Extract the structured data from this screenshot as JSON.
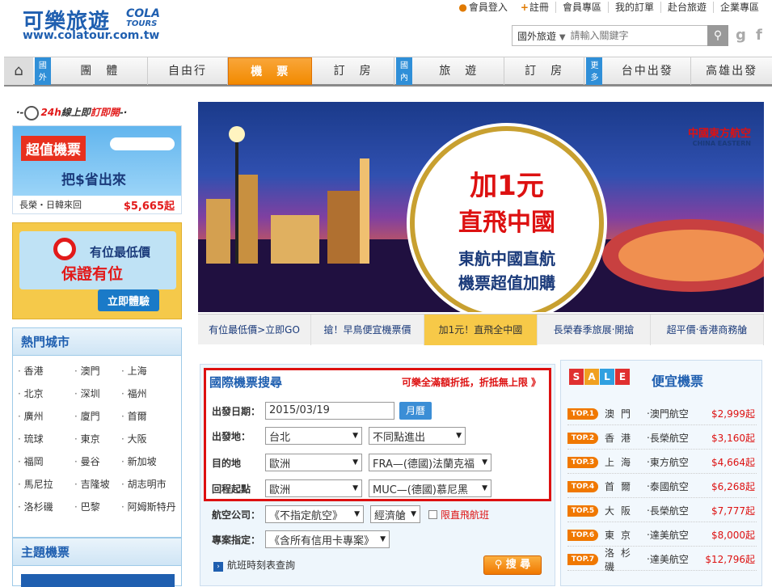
{
  "logo": {
    "cn": "可樂旅遊",
    "tag1": "COLA",
    "tag2": "TOURS",
    "url": "www.colatour.com.tw"
  },
  "toplinks": [
    "會員登入",
    "註冊",
    "會員專區",
    "我的訂單",
    "赴台旅遊",
    "企業專區"
  ],
  "search": {
    "category": "國外旅遊",
    "placeholder": "請輸入關鍵字"
  },
  "nav": {
    "tag_outer": "國外",
    "tag_inner": "國內",
    "tag_more": "更多",
    "items": [
      "團　體",
      "自由行",
      "機　票",
      "訂　房",
      "旅　遊",
      "訂　房",
      "台中出發",
      "高雄出發"
    ]
  },
  "left": {
    "promo24": {
      "prefix": "24h",
      "text": "線上即",
      "red": "訂即開"
    },
    "ad1": {
      "t1": "超值機票",
      "t2": "把$省出來",
      "route": "長榮・日韓來回",
      "price": "$5,665起"
    },
    "ad2": {
      "l1": "有位最低價",
      "l2": "保證有位",
      "btn": "立即體驗"
    },
    "city_title": "熱門城市",
    "cities": [
      "香港",
      "澳門",
      "上海",
      "北京",
      "深圳",
      "福州",
      "廣州",
      "廈門",
      "首爾",
      "琉球",
      "東京",
      "大阪",
      "福岡",
      "曼谷",
      "新加坡",
      "馬尼拉",
      "吉隆坡",
      "胡志明市",
      "洛杉磯",
      "巴黎",
      "阿姆斯特丹"
    ],
    "theme_title": "主題機票"
  },
  "banner": {
    "a1": "加1元",
    "a2": "直飛中國",
    "a3": "東航中國直航",
    "a4": "機票超值加購",
    "airline_cn": "中國東方航空",
    "airline_en": "CHINA EASTERN"
  },
  "banner_tabs": [
    "有位最低價>立即GO",
    "搶！早鳥便宜機票價",
    "加1元！直飛全中國",
    "長榮春季旅展‧開搶",
    "超平價‧香港商務艙"
  ],
  "form": {
    "title": "國際機票搜尋",
    "slogan": "可樂全滿額折抵，折抵無上限 》",
    "date_label": "出發日期：",
    "date_value": "2015/03/19",
    "calendar_btn": "月曆",
    "from_label": "出發地：",
    "from_value": "台北",
    "from_mode": "不同點進出",
    "dest_label": "目的地",
    "dest_region": "歐洲",
    "dest_city": "FRA—(德國)法蘭克福",
    "ret_label": "回程起點",
    "ret_region": "歐洲",
    "ret_city": "MUC—(德國)慕尼黑",
    "airline_label": "航空公司：",
    "airline_value": "《不指定航空》",
    "cabin_value": "經濟艙",
    "direct_label": "限直飛航班",
    "project_label": "專案指定：",
    "project_value": "《含所有信用卡專案》",
    "timetable": "航班時刻表查詢",
    "search_btn": "搜 尋"
  },
  "sale": {
    "title": "便宜機票",
    "letters": [
      "S",
      "A",
      "L",
      "E"
    ],
    "items": [
      {
        "rank": "TOP.1",
        "city": "澳門",
        "airline": "‧澳門航空",
        "price": "$2,999起"
      },
      {
        "rank": "TOP.2",
        "city": "香港",
        "airline": "‧長榮航空",
        "price": "$3,160起"
      },
      {
        "rank": "TOP.3",
        "city": "上海",
        "airline": "‧東方航空",
        "price": "$4,664起"
      },
      {
        "rank": "TOP.4",
        "city": "首爾",
        "airline": "‧泰國航空",
        "price": "$6,268起"
      },
      {
        "rank": "TOP.5",
        "city": "大阪",
        "airline": "‧長榮航空",
        "price": "$7,777起"
      },
      {
        "rank": "TOP.6",
        "city": "東京",
        "airline": "‧達美航空",
        "price": "$8,000起"
      },
      {
        "rank": "TOP.7",
        "city": "洛杉磯",
        "airline": "‧達美航空",
        "price": "$12,796起"
      }
    ]
  }
}
